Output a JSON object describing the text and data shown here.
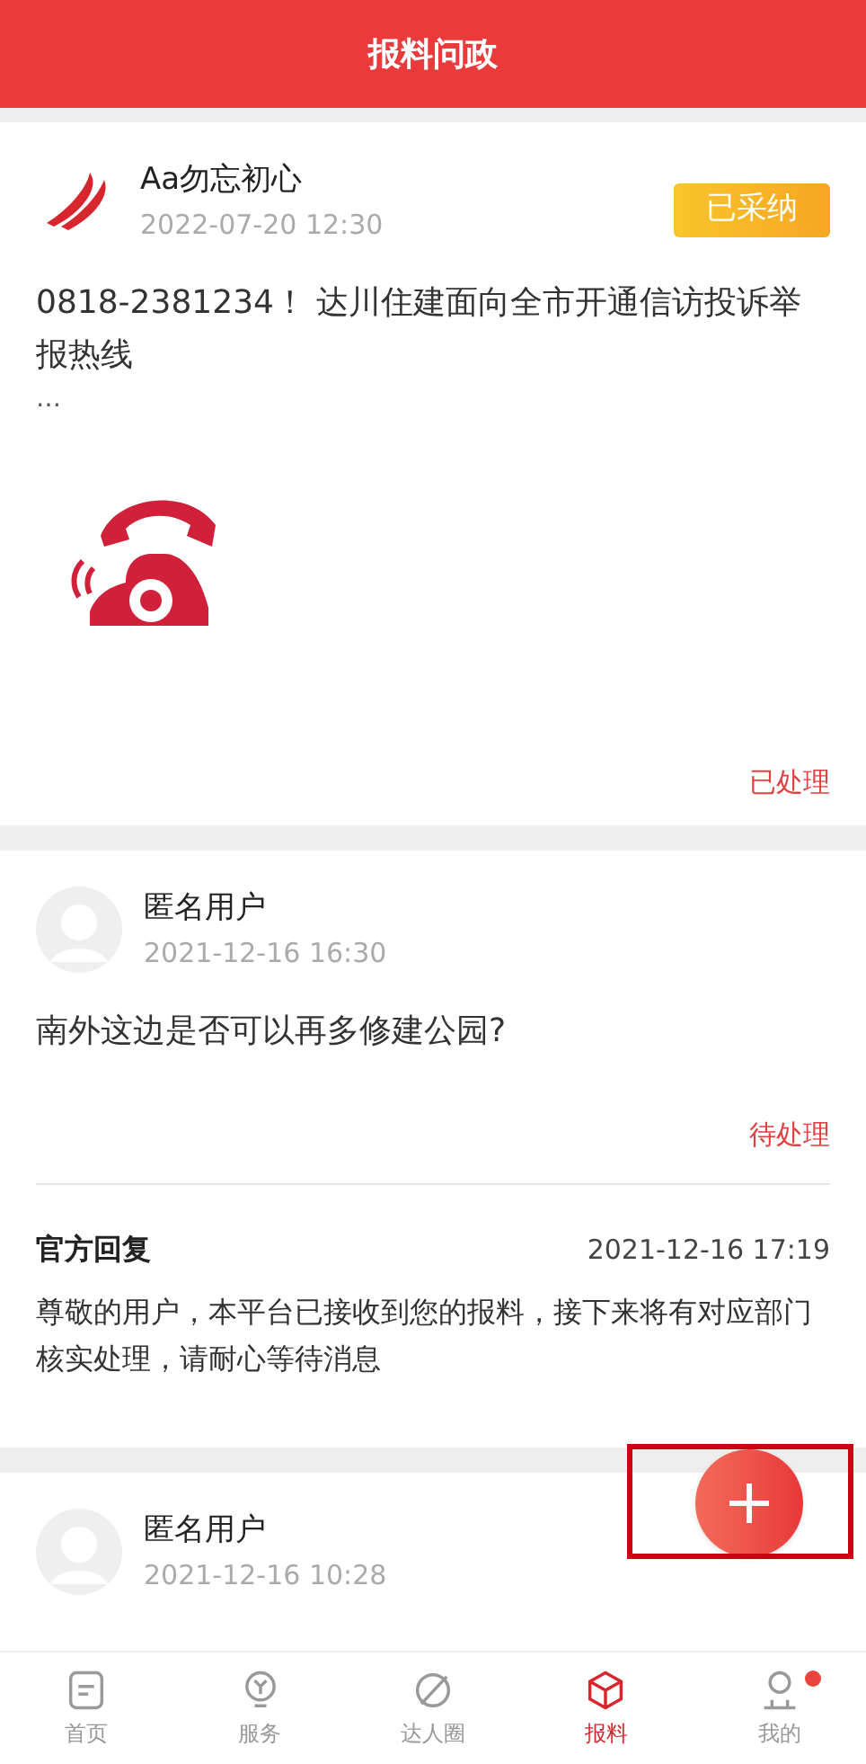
{
  "header": {
    "title": "报料问政"
  },
  "posts": [
    {
      "kind": "logo",
      "user": "Aa勿忘初心",
      "time": "2022-07-20 12:30",
      "badge": "已采纳",
      "content": "0818-2381234！ 达川住建面向全市开通信访投诉举报热线",
      "more": "…",
      "has_image": true,
      "status": "已处理"
    },
    {
      "kind": "anonymous",
      "user": "匿名用户",
      "time": "2021-12-16 16:30",
      "content": "南外这边是否可以再多修建公园?",
      "status": "待处理",
      "reply": {
        "title": "官方回复",
        "time": "2021-12-16 17:19",
        "text": "尊敬的用户，本平台已接收到您的报料，接下来将有对应部门核实处理，请耐心等待消息"
      }
    },
    {
      "kind": "anonymous",
      "user": "匿名用户",
      "time": "2021-12-16 10:28"
    }
  ],
  "fab_highlighted": true,
  "tabs": [
    {
      "label": "首页",
      "kind": "home",
      "selected": false,
      "dot": false
    },
    {
      "label": "服务",
      "kind": "service",
      "selected": false,
      "dot": false
    },
    {
      "label": "达人圈",
      "kind": "circle",
      "selected": false,
      "dot": false
    },
    {
      "label": "报料",
      "kind": "box",
      "selected": true,
      "dot": false
    },
    {
      "label": "我的",
      "kind": "user",
      "selected": false,
      "dot": true
    }
  ]
}
